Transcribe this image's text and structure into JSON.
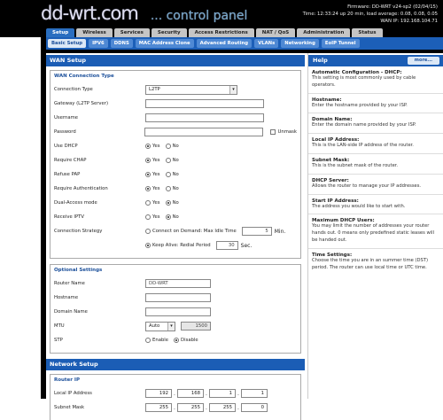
{
  "header": {
    "logo": "dd-wrt.com",
    "logo_sub": "... control panel",
    "firmware": "Firmware: DD-WRT v24-sp2 (02/04/15)",
    "time": "Time: 12:33:24 up 20 min, load average: 0.08, 0.08, 0.05",
    "wan_ip": "WAN IP: 192.168.104.71"
  },
  "tabs": [
    "Setup",
    "Wireless",
    "Services",
    "Security",
    "Access Restrictions",
    "NAT / QoS",
    "Administration",
    "Status"
  ],
  "subtabs": [
    "Basic Setup",
    "IPV6",
    "DDNS",
    "MAC Address Clone",
    "Advanced Routing",
    "VLANs",
    "Networking",
    "EoIP Tunnel"
  ],
  "wan": {
    "title": "WAN Setup",
    "legend": "WAN Connection Type",
    "conn_type_label": "Connection Type",
    "conn_type_value": "L2TP",
    "gateway_label": "Gateway (L2TP Server)",
    "username_label": "Username",
    "password_label": "Password",
    "unmask_label": "Unmask",
    "use_dhcp_label": "Use DHCP",
    "require_chap_label": "Require CHAP",
    "refuse_pap_label": "Refuse PAP",
    "require_auth_label": "Require Authentication",
    "dual_access_label": "Dual-Access mode",
    "receive_iptv_label": "Receive IPTV",
    "conn_strategy_label": "Connection Strategy",
    "yes": "Yes",
    "no": "No",
    "demand_label": "Connect on Demand: Max Idle Time",
    "demand_value": "5",
    "min_label": "Min.",
    "keepalive_label": "Keep Alive: Redial Period",
    "keepalive_value": "30",
    "sec_label": "Sec."
  },
  "optional": {
    "legend": "Optional Settings",
    "router_name_label": "Router Name",
    "router_name_value": "DD-WRT",
    "hostname_label": "Hostname",
    "domain_label": "Domain Name",
    "mtu_label": "MTU",
    "mtu_mode": "Auto",
    "mtu_value": "1500",
    "stp_label": "STP",
    "enable": "Enable",
    "disable": "Disable"
  },
  "network": {
    "title": "Network Setup",
    "legend": "Router IP",
    "local_ip_label": "Local IP Address",
    "local_ip": [
      "192",
      "168",
      "1",
      "1"
    ],
    "subnet_label": "Subnet Mask",
    "subnet": [
      "255",
      "255",
      "255",
      "0"
    ]
  },
  "help": {
    "title": "Help",
    "more": "more...",
    "items": [
      {
        "title": "Automatic Configuration - DHCP:",
        "text": "This setting is most commonly used by cable operators."
      },
      {
        "title": "Hostname:",
        "text": "Enter the hostname provided by your ISP."
      },
      {
        "title": "Domain Name:",
        "text": "Enter the domain name provided by your ISP."
      },
      {
        "title": "Local IP Address:",
        "text": "This is the LAN-side IP address of the router."
      },
      {
        "title": "Subnet Mask:",
        "text": "This is the subnet mask of the router."
      },
      {
        "title": "DHCP Server:",
        "text": "Allows the router to manage your IP addresses."
      },
      {
        "title": "Start IP Address:",
        "text": "The address you would like to start with."
      },
      {
        "title": "Maximum DHCP Users:",
        "text": "You may limit the number of addresses your router hands out. 0 means only predefined static leases will be handed out."
      },
      {
        "title": "Time Settings:",
        "text": "Choose the time you are in an summer time (DST) period. The router can use local time or UTC time."
      }
    ]
  }
}
